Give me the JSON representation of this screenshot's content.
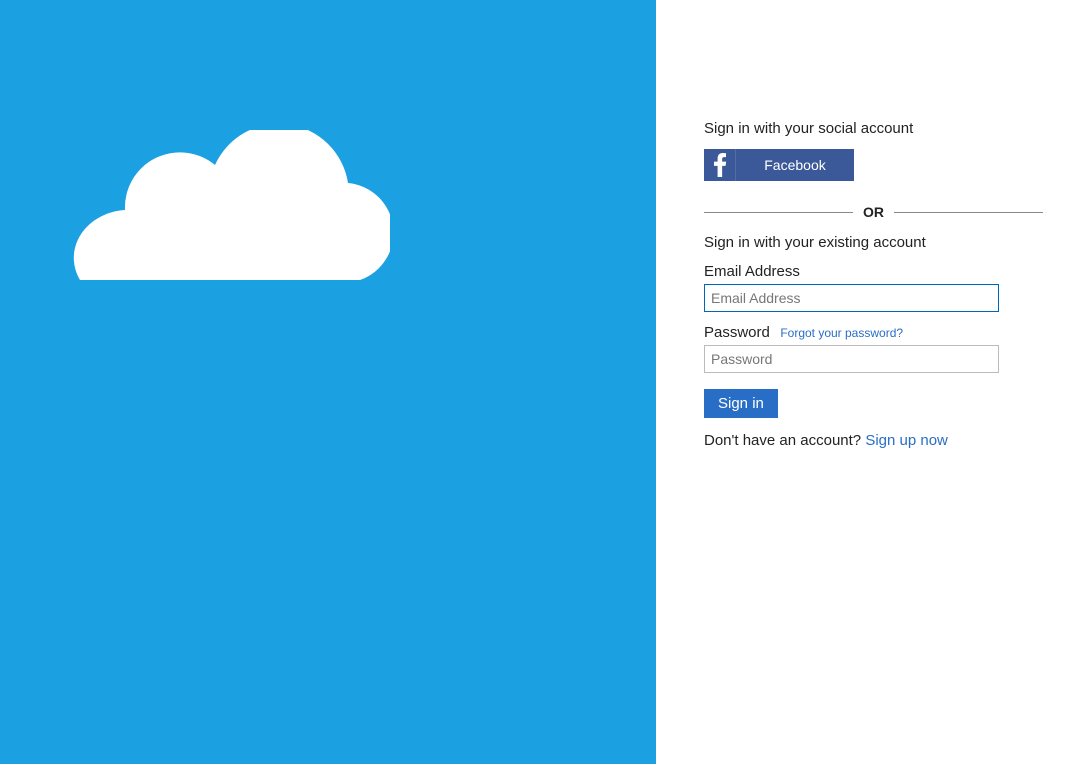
{
  "social": {
    "heading": "Sign in with your social account",
    "facebook_label": "Facebook"
  },
  "divider": {
    "or": "OR"
  },
  "form": {
    "heading": "Sign in with your existing account",
    "email_label": "Email Address",
    "email_placeholder": "Email Address",
    "password_label": "Password",
    "password_placeholder": "Password",
    "forgot_link": "Forgot your password?",
    "signin_button": "Sign in"
  },
  "signup": {
    "prompt": "Don't have an account? ",
    "link": "Sign up now"
  }
}
